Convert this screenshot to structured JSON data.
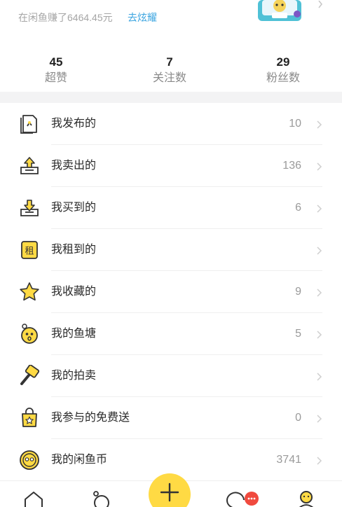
{
  "header": {
    "earned_text": "在闲鱼赚了6464.45元",
    "brag_link": "去炫耀"
  },
  "stats": [
    {
      "value": "45",
      "label": "超赞"
    },
    {
      "value": "7",
      "label": "关注数"
    },
    {
      "value": "29",
      "label": "粉丝数"
    }
  ],
  "menu": [
    {
      "label": "我发布的",
      "count": "10",
      "icon": "published-icon"
    },
    {
      "label": "我卖出的",
      "count": "136",
      "icon": "sold-icon"
    },
    {
      "label": "我买到的",
      "count": "6",
      "icon": "bought-icon"
    },
    {
      "label": "我租到的",
      "count": "",
      "icon": "rented-icon",
      "icon_text": "租"
    },
    {
      "label": "我收藏的",
      "count": "9",
      "icon": "star-icon"
    },
    {
      "label": "我的鱼塘",
      "count": "5",
      "icon": "fishpond-icon"
    },
    {
      "label": "我的拍卖",
      "count": "",
      "icon": "auction-hammer-icon"
    },
    {
      "label": "我参与的免费送",
      "count": "0",
      "icon": "free-gift-bag-icon"
    },
    {
      "label": "我的闲鱼币",
      "count": "3741",
      "icon": "xianyu-coin-icon"
    }
  ],
  "tabbar": {
    "tabs": [
      "home-icon",
      "fishpond-tab-icon",
      "publish-plus-icon",
      "message-icon",
      "profile-icon"
    ],
    "message_badge": "•••"
  },
  "colors": {
    "accent_yellow": "#ffda44",
    "link_blue": "#3aa4e0",
    "badge_red": "#f04a3e",
    "band_gray": "#f3f3f4"
  }
}
